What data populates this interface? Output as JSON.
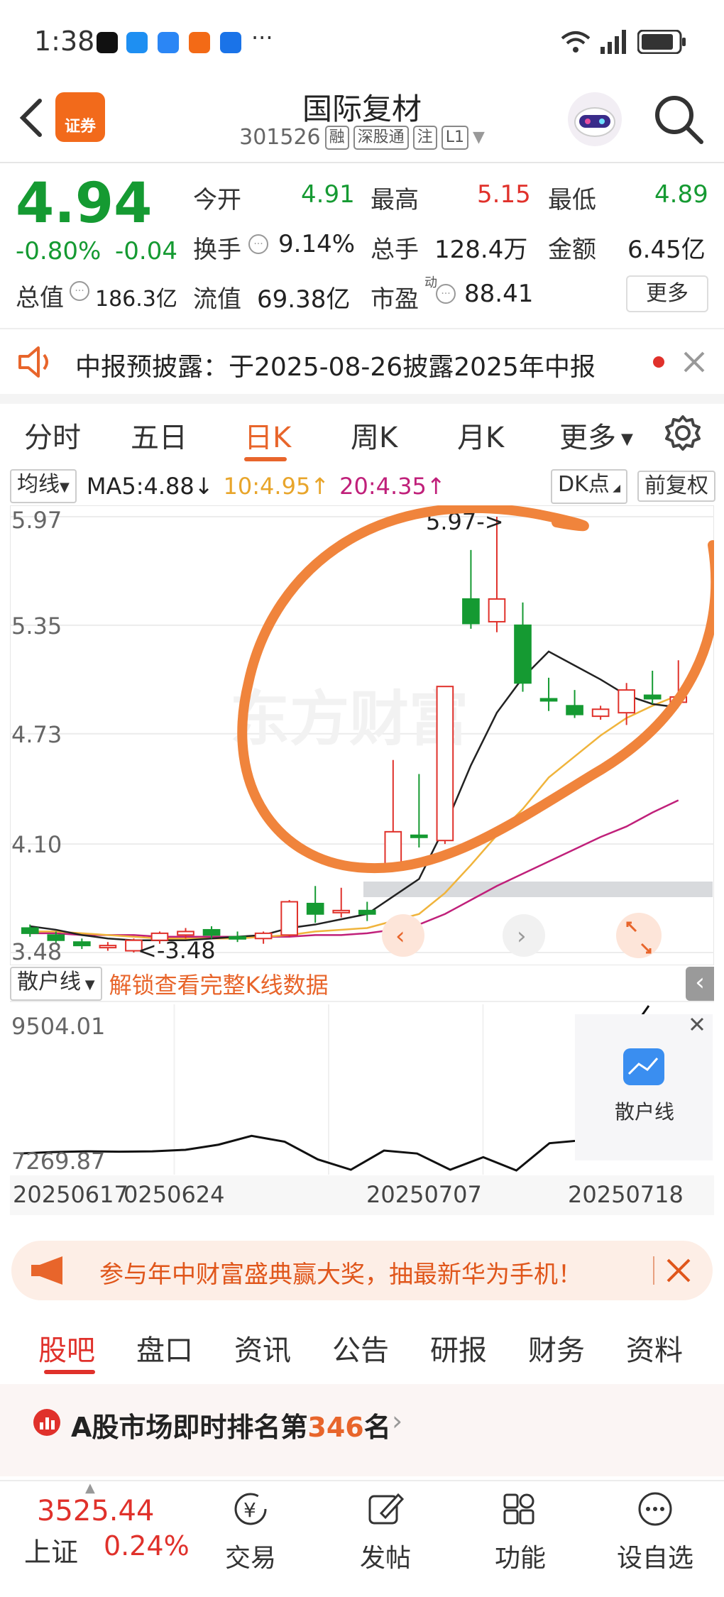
{
  "status_bar": {
    "time": "1:38",
    "more": "···",
    "battery": "battery-icon",
    "signal": "signal-icon",
    "wifi": "wifi-icon"
  },
  "header": {
    "title": "国际复材",
    "code": "301526",
    "tags": [
      "融",
      "深股通",
      "注",
      "L1"
    ],
    "logo_text": "证券"
  },
  "quote": {
    "price": "4.94",
    "change_pct": "-0.80%",
    "change": "-0.04",
    "open_label": "今开",
    "open": "4.91",
    "high_label": "最高",
    "high": "5.15",
    "low_label": "最低",
    "low": "4.89",
    "turnover_label": "换手",
    "turnover": "9.14%",
    "volume_label": "总手",
    "volume": "128.4万",
    "amount_label": "金额",
    "amount": "6.45亿",
    "mktcap_label": "总值",
    "mktcap": "186.3亿",
    "float_label": "流值",
    "float": "69.38亿",
    "pe_label": "市盈",
    "pe_sup": "动",
    "pe": "88.41",
    "more_label": "更多"
  },
  "notice": {
    "text": "中报预披露：于2025-08-26披露2025年中报"
  },
  "chart_tabs": [
    "分时",
    "五日",
    "日K",
    "周K",
    "月K",
    "更多"
  ],
  "indicator_bar": {
    "ma_select": "均线",
    "ma5": "MA5:4.88↓",
    "ma10": "10:4.95↑",
    "ma20": "20:4.35↑",
    "dk_button": "DK点",
    "fq_button": "前复权"
  },
  "colors": {
    "up": "#e0312b",
    "down": "#159a32",
    "accent": "#e8652b",
    "ma5": "#222222",
    "ma10": "#f0b43c",
    "ma20": "#c0207a",
    "annotation": "#f0843c"
  },
  "chart_data": [
    {
      "type": "candlestick",
      "y_ticks": [
        "5.97",
        "5.35",
        "4.73",
        "4.10",
        "3.48"
      ],
      "ylim": [
        3.48,
        5.97
      ],
      "max_label": "5.97->",
      "min_label": "<-3.48",
      "watermark": "东方财富",
      "candles": [
        {
          "o": 3.62,
          "h": 3.64,
          "l": 3.57,
          "c": 3.59
        },
        {
          "o": 3.58,
          "h": 3.6,
          "l": 3.53,
          "c": 3.55
        },
        {
          "o": 3.54,
          "h": 3.56,
          "l": 3.5,
          "c": 3.52
        },
        {
          "o": 3.52,
          "h": 3.54,
          "l": 3.49,
          "c": 3.52
        },
        {
          "o": 3.49,
          "h": 3.56,
          "l": 3.48,
          "c": 3.55
        },
        {
          "o": 3.55,
          "h": 3.6,
          "l": 3.53,
          "c": 3.59
        },
        {
          "o": 3.58,
          "h": 3.62,
          "l": 3.56,
          "c": 3.6
        },
        {
          "o": 3.61,
          "h": 3.63,
          "l": 3.56,
          "c": 3.58
        },
        {
          "o": 3.57,
          "h": 3.6,
          "l": 3.54,
          "c": 3.56
        },
        {
          "o": 3.56,
          "h": 3.6,
          "l": 3.53,
          "c": 3.59
        },
        {
          "o": 3.58,
          "h": 3.78,
          "l": 3.57,
          "c": 3.77
        },
        {
          "o": 3.76,
          "h": 3.86,
          "l": 3.65,
          "c": 3.7
        },
        {
          "o": 3.71,
          "h": 3.85,
          "l": 3.68,
          "c": 3.72
        },
        {
          "o": 3.72,
          "h": 3.77,
          "l": 3.66,
          "c": 3.7
        },
        {
          "o": 3.98,
          "h": 4.58,
          "l": 3.96,
          "c": 4.17
        },
        {
          "o": 4.15,
          "h": 4.5,
          "l": 4.08,
          "c": 4.14
        },
        {
          "o": 4.12,
          "h": 5.0,
          "l": 4.1,
          "c": 5.0
        },
        {
          "o": 5.5,
          "h": 5.78,
          "l": 5.33,
          "c": 5.36
        },
        {
          "o": 5.37,
          "h": 5.97,
          "l": 5.31,
          "c": 5.5
        },
        {
          "o": 5.35,
          "h": 5.48,
          "l": 4.97,
          "c": 5.02
        },
        {
          "o": 4.93,
          "h": 5.05,
          "l": 4.86,
          "c": 4.92
        },
        {
          "o": 4.89,
          "h": 4.98,
          "l": 4.82,
          "c": 4.84
        },
        {
          "o": 4.83,
          "h": 4.89,
          "l": 4.81,
          "c": 4.87
        },
        {
          "o": 4.85,
          "h": 5.02,
          "l": 4.78,
          "c": 4.98
        },
        {
          "o": 4.95,
          "h": 5.09,
          "l": 4.9,
          "c": 4.93
        },
        {
          "o": 4.91,
          "h": 5.15,
          "l": 4.89,
          "c": 4.94
        }
      ],
      "ma5": [
        3.63,
        3.61,
        3.58,
        3.56,
        3.55,
        3.55,
        3.55,
        3.56,
        3.57,
        3.58,
        3.62,
        3.64,
        3.67,
        3.7,
        3.8,
        3.9,
        4.2,
        4.55,
        4.85,
        5.05,
        5.2,
        5.12,
        5.04,
        4.95,
        4.9,
        4.88
      ],
      "ma10": [
        3.6,
        3.6,
        3.59,
        3.58,
        3.57,
        3.56,
        3.56,
        3.56,
        3.56,
        3.57,
        3.58,
        3.6,
        3.61,
        3.62,
        3.66,
        3.7,
        3.82,
        3.98,
        4.15,
        4.3,
        4.48,
        4.6,
        4.72,
        4.82,
        4.89,
        4.95
      ],
      "ma20": [
        3.59,
        3.59,
        3.58,
        3.58,
        3.58,
        3.57,
        3.57,
        3.57,
        3.57,
        3.57,
        3.57,
        3.58,
        3.58,
        3.59,
        3.61,
        3.64,
        3.7,
        3.78,
        3.86,
        3.93,
        4.0,
        4.07,
        4.14,
        4.2,
        4.28,
        4.35
      ]
    },
    {
      "type": "line",
      "title": "散户线",
      "unlock_text": "解锁查看完整K线数据",
      "y_ticks": [
        "9504.01",
        "7269.87"
      ],
      "ylim": [
        7269.87,
        9504.01
      ],
      "x_labels": [
        "20250617",
        "0250624",
        "20250707",
        "20250718"
      ],
      "values": [
        7480,
        7500,
        7510,
        7505,
        7510,
        7530,
        7600,
        7720,
        7640,
        7400,
        7260,
        7520,
        7480,
        7260,
        7430,
        7250,
        7620,
        7660,
        8850,
        9500
      ],
      "badge_label": "散户线"
    }
  ],
  "promo": {
    "text": "参与年中财富盛典赢大奖，抽最新华为手机！"
  },
  "lower_tabs": [
    "股吧",
    "盘口",
    "资讯",
    "公告",
    "研报",
    "财务",
    "资料"
  ],
  "ranking": {
    "prefix": "A股市场即时排名第",
    "rank": "346",
    "suffix": "名"
  },
  "bottom_nav": {
    "index_value": "3525.44",
    "index_name": "上证",
    "index_change": "0.24%",
    "items": [
      "交易",
      "发帖",
      "功能",
      "设自选"
    ]
  }
}
